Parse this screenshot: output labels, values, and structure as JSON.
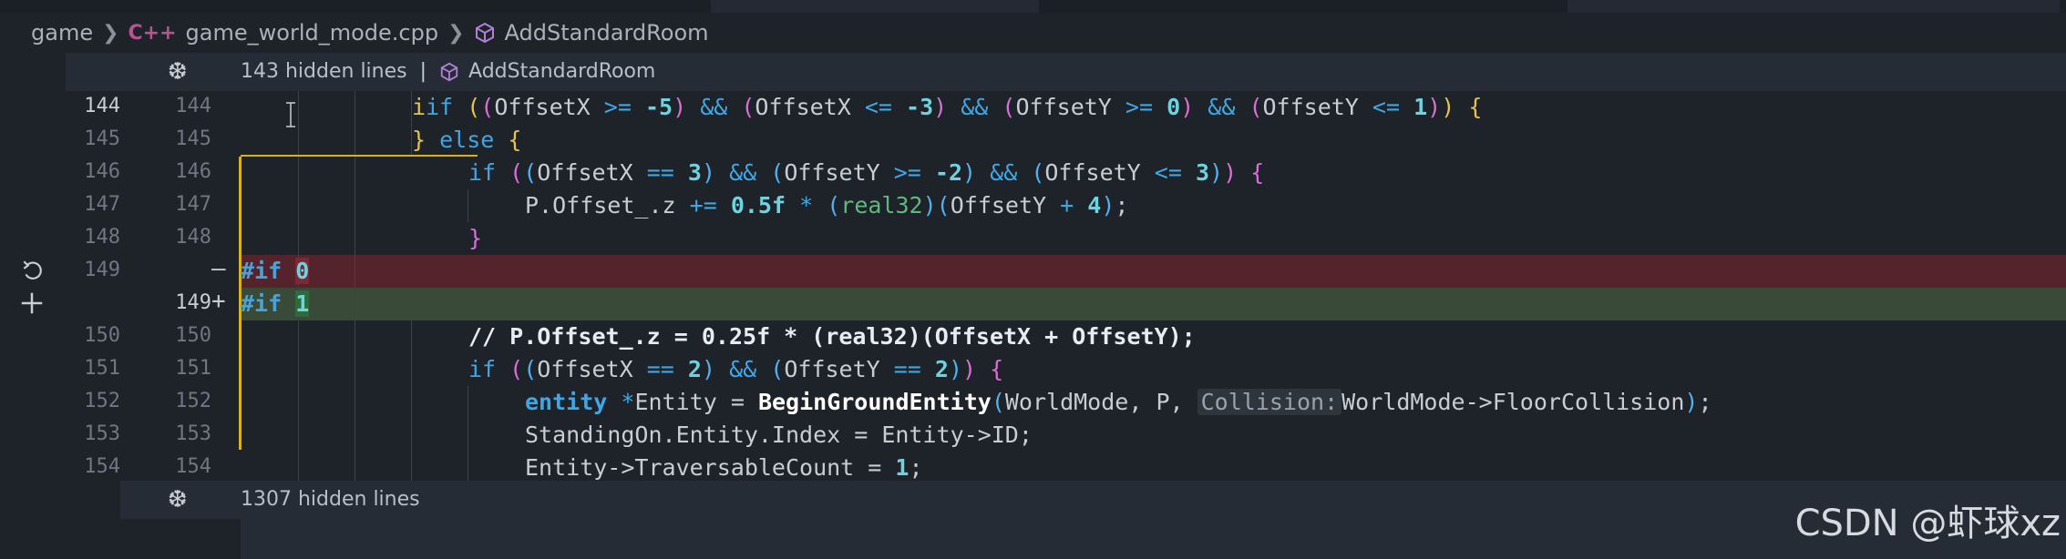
{
  "breadcrumb": {
    "folder": "game",
    "file_icon": "C++",
    "file": "game_world_mode.cpp",
    "symbol": "AddStandardRoom"
  },
  "hidden_top": {
    "text": "143 hidden lines",
    "symbol": "AddStandardRoom"
  },
  "hidden_bottom": {
    "text": "1307 hidden lines"
  },
  "gutter": {
    "old": [
      "144",
      "145",
      "146",
      "147",
      "148",
      "149",
      "",
      "150",
      "151",
      "152",
      "153",
      "154"
    ],
    "new": [
      "144",
      "145",
      "146",
      "147",
      "148",
      "",
      "149",
      "150",
      "151",
      "152",
      "153",
      "154"
    ],
    "del_marker": "—",
    "add_marker": "+"
  },
  "code": {
    "if_kw": "if",
    "else_kw": "else",
    "offsetx": "OffsetX",
    "offsety": "OffsetY",
    "ge": ">=",
    "le": "<=",
    "eq": "==",
    "and": "&&",
    "neg5": "-5",
    "neg3": "-3",
    "neg2": "-2",
    "zero": "0",
    "one": "1",
    "two": "2",
    "three": "3",
    "four": "4",
    "p_offset_z": "P.Offset_.z",
    "plus_eq": "+=",
    "half": "0.5f",
    "star": "*",
    "plus": "+",
    "real32": "real32",
    "pp_if": "#if",
    "comment": "// P.Offset_.z = 0.25f * (real32)(OffsetX + OffsetY);",
    "entity_type": "entity",
    "entity_var": "*Entity",
    "assign": "=",
    "fn_name": "BeginGroundEntity",
    "args1": "WorldMode, P,",
    "hint": "Collision:",
    "args2": "WorldMode->FloorCollision",
    "standing": "StandingOn.Entity.Index = Entity->ID;",
    "traversable": "Entity->TraversableCount = ",
    "semicolon": ";",
    "close_brace": "}",
    "open_brace": "{"
  },
  "watermark": "CSDN @虾球xz"
}
